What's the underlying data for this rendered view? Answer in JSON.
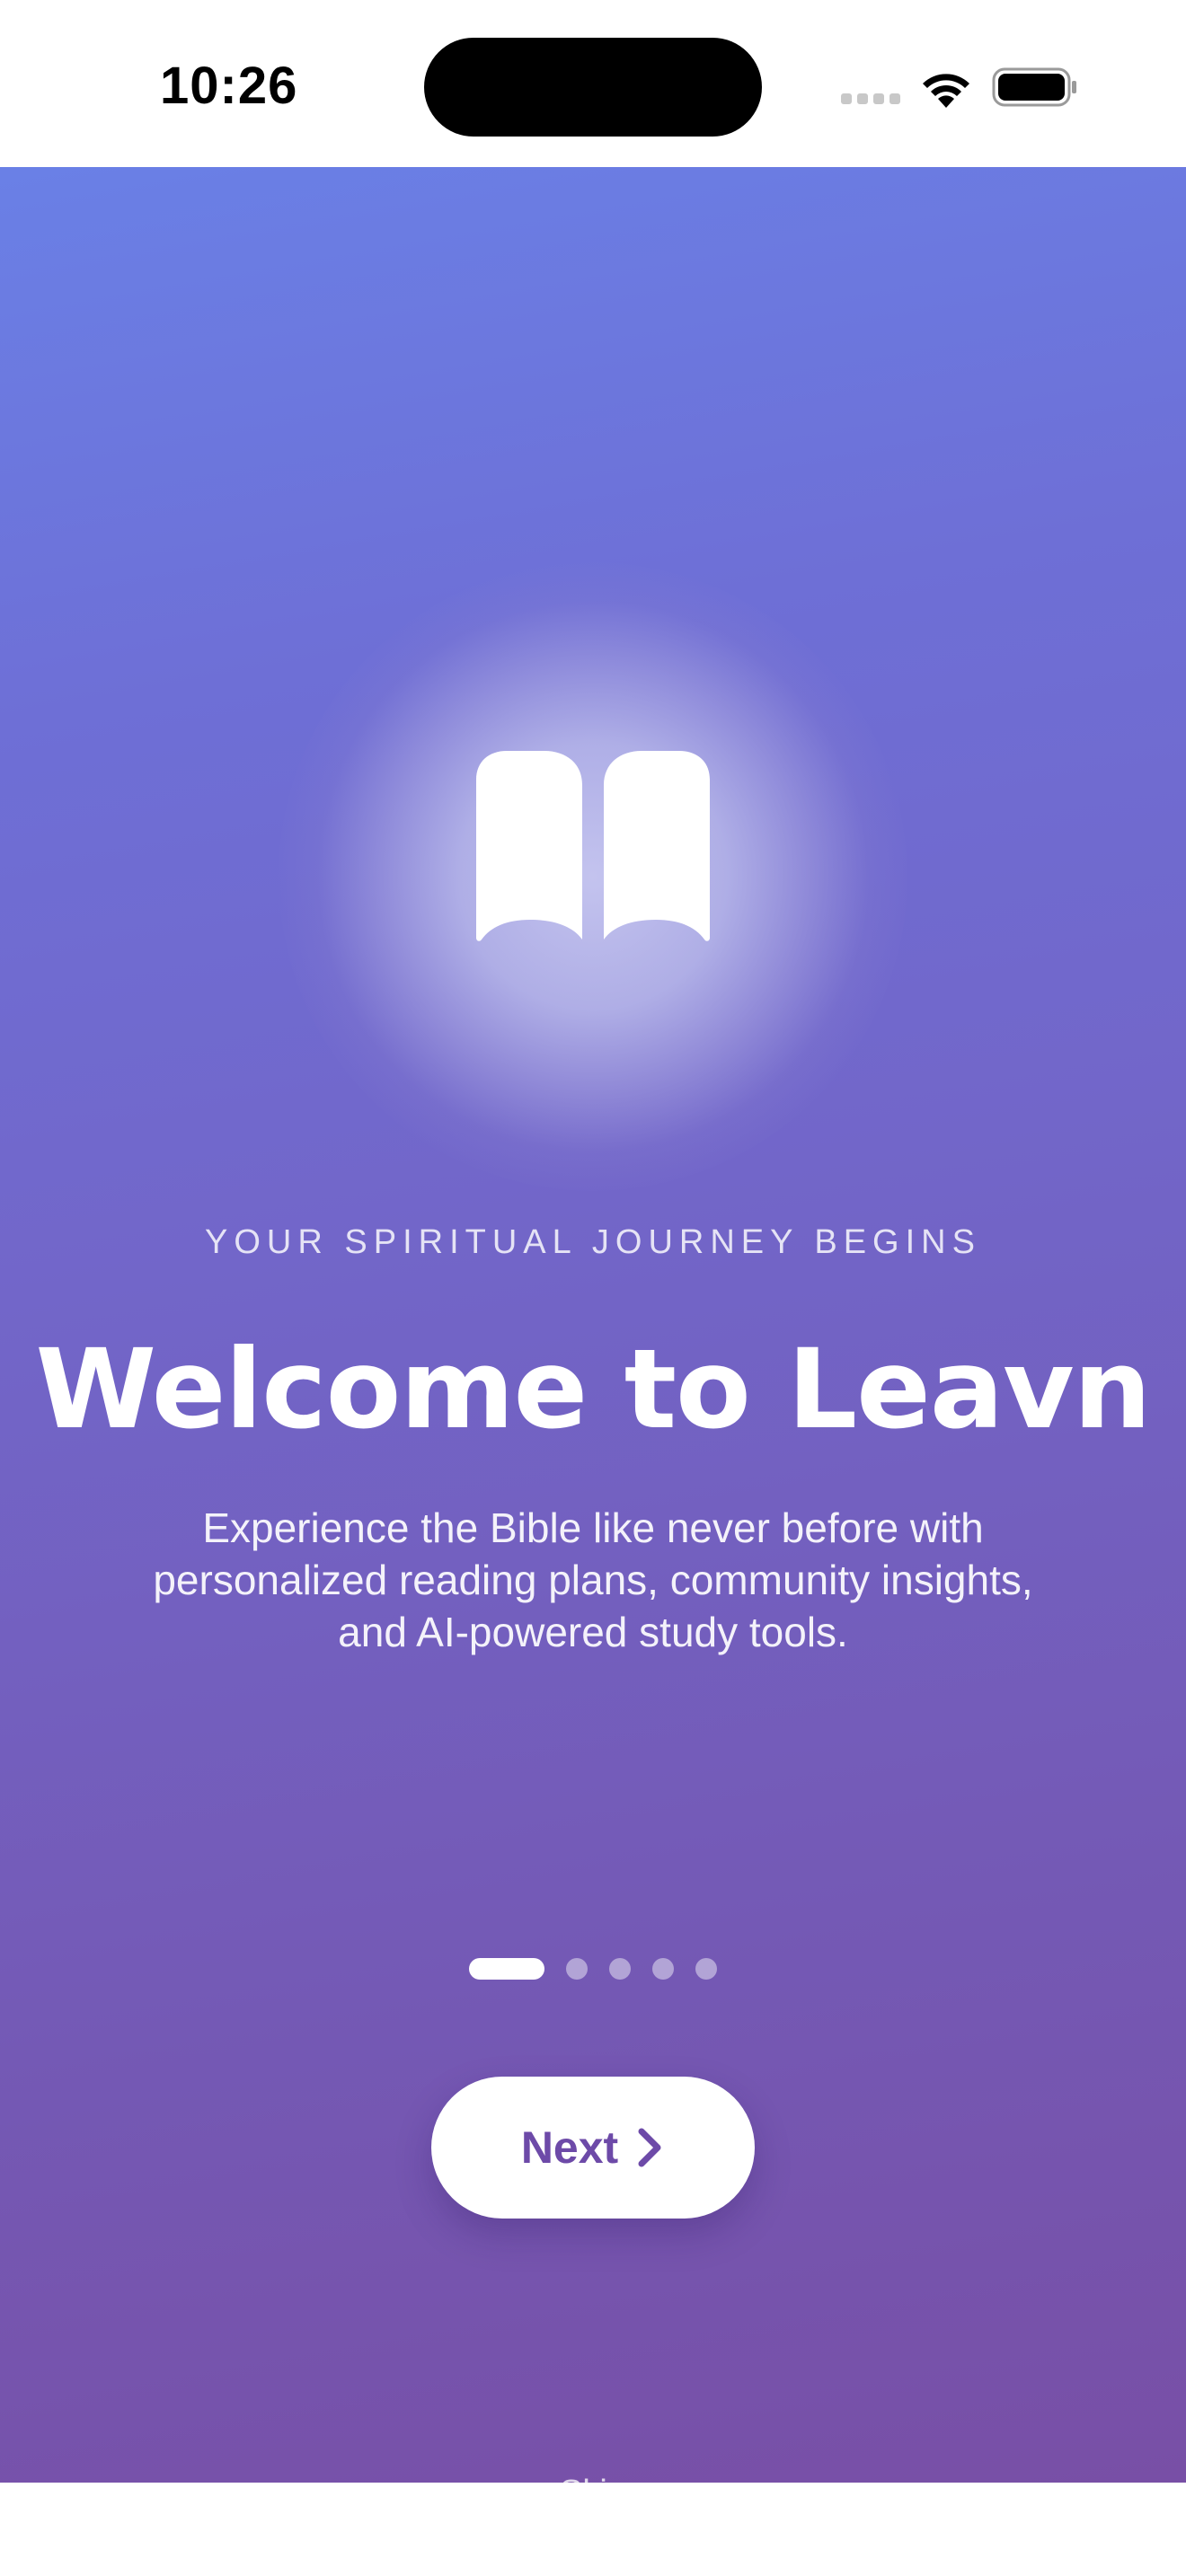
{
  "status_bar": {
    "time": "10:26",
    "icons": [
      "cellular-signal-icon",
      "wifi-icon",
      "battery-icon"
    ]
  },
  "onboarding": {
    "hero_icon": "book-open-icon",
    "subtitle": "YOUR SPIRITUAL JOURNEY BEGINS",
    "title": "Welcome to Leavn",
    "description": "Experience the Bible like never before with personalized reading plans, community insights, and AI-powered study tools.",
    "pagination": {
      "total_pages": 5,
      "current_page": 1
    },
    "next_button": {
      "label": "Next",
      "icon": "chevron-right-icon"
    },
    "skip_label": "Skip"
  },
  "colors": {
    "gradient_top": "#6a80e6",
    "gradient_bottom": "#784fa6",
    "button_text": "#6d4aa8",
    "background": "#ffffff"
  }
}
